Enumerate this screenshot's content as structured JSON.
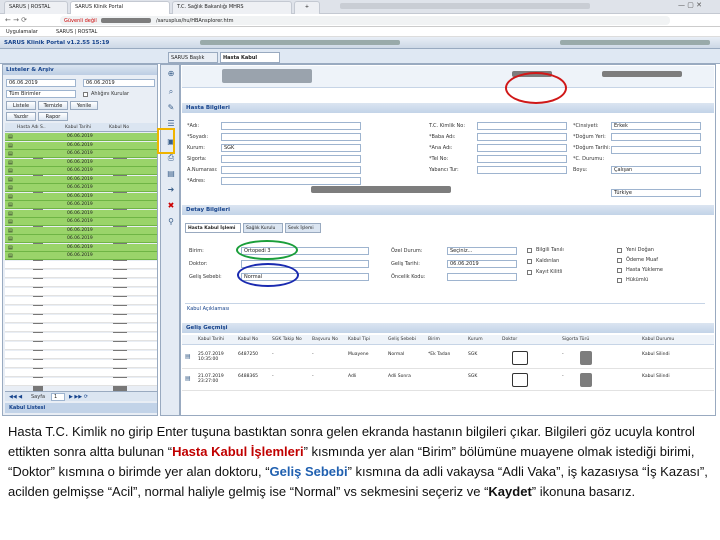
{
  "browser": {
    "tabs": [
      "SARUS | ROSTAL",
      "SARUS Klinik Portal",
      "T.C. Sağlık Bakanlığı MHRS",
      ""
    ],
    "security_text": "Güvenli değil",
    "url": "/sarusplus/hu/HBAnsplorer.htm",
    "bookmarks": [
      "Uygulamalar",
      "SARUS | ROSTAL"
    ]
  },
  "app": {
    "title": "SARUS Klinik Portal  v1.2.55 15:19",
    "left_panel_title": "Listeler & Arşiv",
    "date_from": "06.06.2019",
    "date_to": "06.06.2019",
    "filter_select": "Tüm Birimler",
    "filter_all_label": "Ahlığını Kurular",
    "btn_list": "Listele",
    "btn_clean": "Temizle",
    "btn_refresh": "Yenile",
    "btn_print": "Yazdır",
    "btn_report": "Rapor",
    "col_name": "Hasta Adı S..",
    "col_date": "Kabul Tarihi",
    "col_no": "Kabul No",
    "list_dates": [
      "06.06.2019",
      "06.06.2019",
      "06.06.2019",
      "06.06.2019",
      "06.06.2019",
      "06.06.2019",
      "06.06.2019",
      "06.06.2019",
      "06.06.2019",
      "06.06.2019",
      "06.06.2019",
      "06.06.2019",
      "06.06.2019",
      "06.06.2019",
      "06.06.2019"
    ],
    "pager_label": "Sayfa",
    "pager_page": "1",
    "bottom_label": "Kabul Listesi",
    "tabs": [
      "SARUS Başlık",
      "Hasta Kabul"
    ],
    "section_patient": "Hasta Bilgileri",
    "patient_fields_left": [
      "*Adı:",
      "*Soyadı:",
      "Kurum:",
      "Sigorta:",
      "A.Numarası:",
      "*Adres:"
    ],
    "kurum_value": "SGK",
    "patient_fields_mid": [
      "T.C. Kimlik No:",
      "*Baba Adı:",
      "*Ana Adı:",
      "*Tel No:",
      "Yabancı Tur:"
    ],
    "patient_fields_right": [
      "*Cinsiyeti:",
      "*Doğum Yeri:",
      "*Doğum Tarihi:",
      "*C. Durumu:",
      "Boyu:"
    ],
    "cinsiyet_value": "Erkek",
    "cdurum_value": "Çalışan",
    "boyu_value": "Türkiye",
    "section_detail": "Detay Bilgileri",
    "detail_tabs": [
      "Hasta Kabul İşlemi",
      "Sağlık Kurulu",
      "Sevk İşlemi"
    ],
    "birim_label": "Birim:",
    "birim_value": "Ortopedi 3",
    "doktor_label": "Doktor:",
    "gelis_label": "Geliş Sebebi:",
    "gelis_value": "Normal",
    "ozel_durum_label": "Özel Durum:",
    "ozel_durum_value": "Seçiniz...",
    "gelis_tarihi_label": "Geliş Tarihi:",
    "gelis_tarihi_value": "06.06.2019",
    "oncelik_label": "Öncelik Kodu:",
    "checks_col1": [
      "Bilgili Tanılı",
      "Kaldırılan",
      "Kayıt Kilitli"
    ],
    "checks_col2": [
      "Yeni Doğan",
      "Ödeme Muaf",
      "Hasta Yükleme",
      "Hükümlü"
    ],
    "kabul_aciklamasi": "Kabul Açıklaması",
    "section_history": "Geliş Geçmişi",
    "hist_cols": [
      "Kabul Tarihi",
      "Kabul No",
      "SGK Takip No",
      "Başvuru No",
      "Kabul Tipi",
      "Geliş Sebebi",
      "Birim",
      "Kurum",
      "Doktor",
      "Sigorta Türü",
      "Kabul Durumu"
    ],
    "hist_rows": [
      {
        "date": "25.07.2019 10:35:00",
        "no": "6487250",
        "sgk": "-",
        "bas": "-",
        "tip": "Muayene",
        "sebep": "Normal",
        "birim": "*Ek Tadan",
        "kurum": "SGK",
        "sig": "-",
        "durum": "Kabul Silindi"
      },
      {
        "date": "21.07.2019 23:27:00",
        "no": "6488365",
        "sgk": "-",
        "bas": "-",
        "tip": "Adli",
        "sebep": "Adli Sonra",
        "birim": "",
        "kurum": "SGK",
        "sig": "-",
        "durum": "Kabul Silindi"
      }
    ]
  },
  "caption": {
    "p1": "Hasta T.C. Kimlik no girip Enter tuşuna bastıktan sonra gelen ekranda hastanın bilgileri çıkar. Bilgileri göz ucuyla kontrol ettikten sonra altta bulunan “",
    "hk": "Hasta Kabul İşlemleri",
    "p2": "” kısmında yer alan “Birim” bölümüne muayene olmak istediği birimi, “Doktor” kısmına o birimde yer alan doktoru, “",
    "gs": "Geliş Sebebi",
    "p3": "” kısmına da adli vakaysa “Adli Vaka”, iş kazasıysa “İş Kazası”, acilden gelmişse “Acil”, normal haliyle gelmiş ise “Normal” vs sekmesini seçeriz ve “",
    "kd": "Kaydet",
    "p4": "” ikonuna basarız."
  },
  "colors": {
    "green_row": "#9ad46a",
    "red_ring": "#d01818",
    "green_ring": "#1a9e3a",
    "blue_ring": "#1a2ab0",
    "yellow_box": "#f0b400"
  }
}
